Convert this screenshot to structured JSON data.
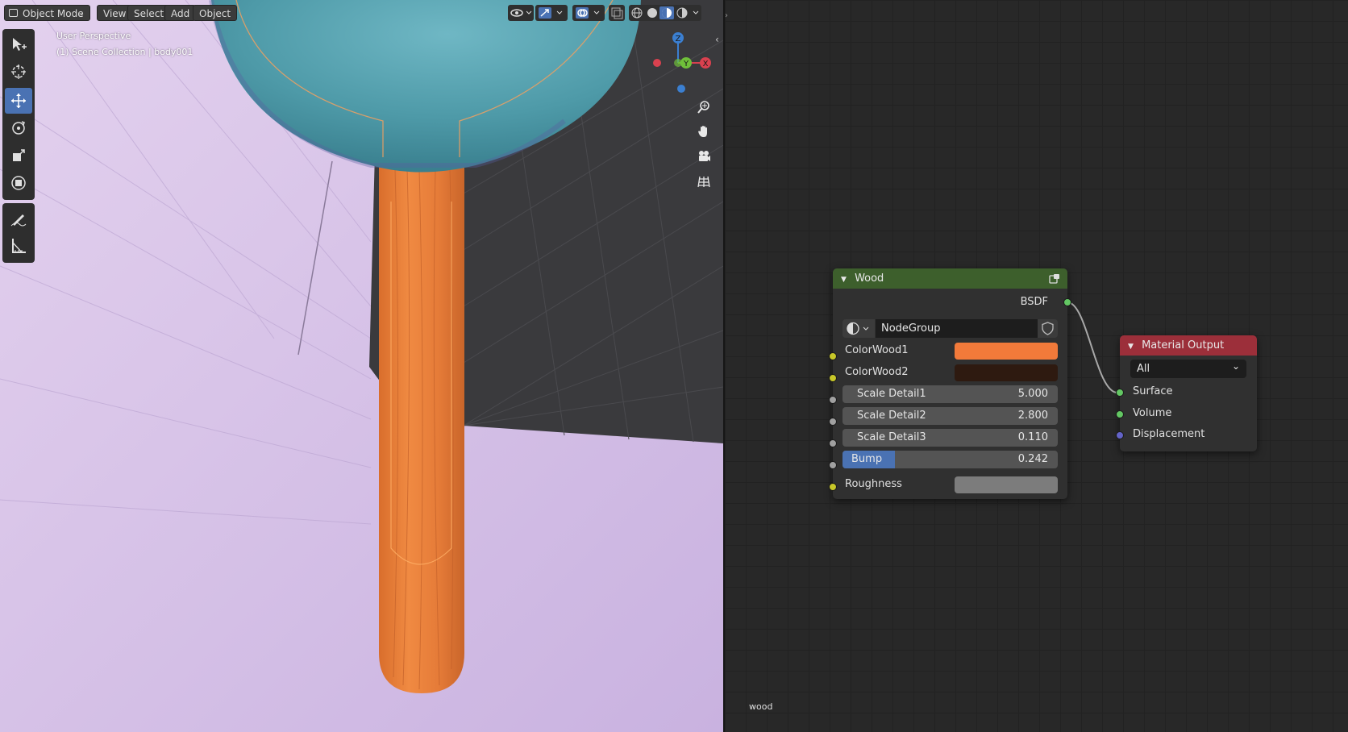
{
  "header": {
    "mode_label": "Object Mode",
    "menus": [
      "View",
      "Select",
      "Add",
      "Object"
    ]
  },
  "viewport": {
    "perspective_label": "User Perspective",
    "collection_label": "(1) Scene Collection | body001",
    "gizmo": {
      "x": "X",
      "y": "Y",
      "z": "Z"
    }
  },
  "tools": [
    {
      "name": "select-box",
      "icon": "select-cursor-icon",
      "active": false
    },
    {
      "name": "cursor",
      "icon": "3d-cursor-icon",
      "active": false
    },
    {
      "name": "move",
      "icon": "move-arrows-icon",
      "active": true
    },
    {
      "name": "rotate",
      "icon": "rotate-icon",
      "active": false
    },
    {
      "name": "scale",
      "icon": "scale-icon",
      "active": false
    },
    {
      "name": "transform",
      "icon": "transform-icon",
      "active": false
    },
    {
      "name": "annotate",
      "icon": "annotate-pencil-icon",
      "active": false
    },
    {
      "name": "measure",
      "icon": "measure-ruler-icon",
      "active": false
    }
  ],
  "nav_icons": [
    "zoom-icon",
    "hand-pan-icon",
    "camera-icon",
    "grid-ortho-icon"
  ],
  "wood_node": {
    "title": "Wood",
    "output_label": "BSDF",
    "group_name": "NodeGroup",
    "inputs": {
      "colorwood1": {
        "label": "ColorWood1",
        "color": "#f27a3a"
      },
      "colorwood2": {
        "label": "ColorWood2",
        "color": "#2e1a10"
      },
      "scale1": {
        "label": "Scale Detail1",
        "value": "5.000"
      },
      "scale2": {
        "label": "Scale Detail2",
        "value": "2.800"
      },
      "scale3": {
        "label": "Scale Detail3",
        "value": "0.110"
      },
      "bump": {
        "label": "Bump",
        "value": "0.242",
        "fraction": 0.242
      },
      "roughness": {
        "label": "Roughness",
        "color": "#7c7c7c"
      }
    },
    "header_color": "#3d5f2c"
  },
  "material_output": {
    "title": "Material Output",
    "target": "All",
    "inputs": [
      "Surface",
      "Volume",
      "Displacement"
    ],
    "header_color": "#9c2f3a"
  },
  "material_name": "wood",
  "colors": {
    "socket_yellow": "#c7c729",
    "socket_grey": "#a1a1a1",
    "socket_green": "#63c763",
    "socket_purple": "#6363c7",
    "accent_blue": "#4a72b3"
  }
}
